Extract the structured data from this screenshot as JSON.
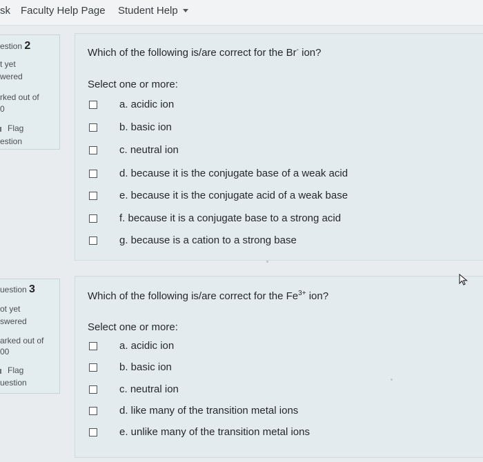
{
  "nav": {
    "items": [
      "sk",
      "Faculty Help Page",
      "Student Help"
    ]
  },
  "questions": [
    {
      "info": {
        "label": "estion",
        "number": "2",
        "status1": "t yet",
        "status2": "wered",
        "marked": "rked out of",
        "points": "0",
        "flag1": "Flag",
        "flag2": "estion"
      },
      "text_before": "Which of the following is/are correct for the Br",
      "superscript": "-",
      "text_after": " ion?",
      "prompt": "Select one or more:",
      "options": [
        "a. acidic ion",
        "b. basic ion",
        "c. neutral ion",
        "d. because it is the conjugate base of a weak acid",
        "e. because it is the conjugate acid of a weak base",
        "f. because it is a conjugate base to a strong acid",
        "g. because is a cation to a strong base"
      ]
    },
    {
      "info": {
        "label": "uestion",
        "number": "3",
        "status1": "ot yet",
        "status2": "swered",
        "marked": "arked out of",
        "points": "00",
        "flag1": "Flag",
        "flag2": "uestion"
      },
      "text_before": "Which of the following is/are correct for the Fe",
      "superscript": "3+",
      "text_after": " ion?",
      "prompt": "Select one or more:",
      "options": [
        "a. acidic ion",
        "b. basic ion",
        "c. neutral ion",
        "d. like many of the transition metal ions",
        "e. unlike many of the transition metal ions"
      ]
    }
  ]
}
